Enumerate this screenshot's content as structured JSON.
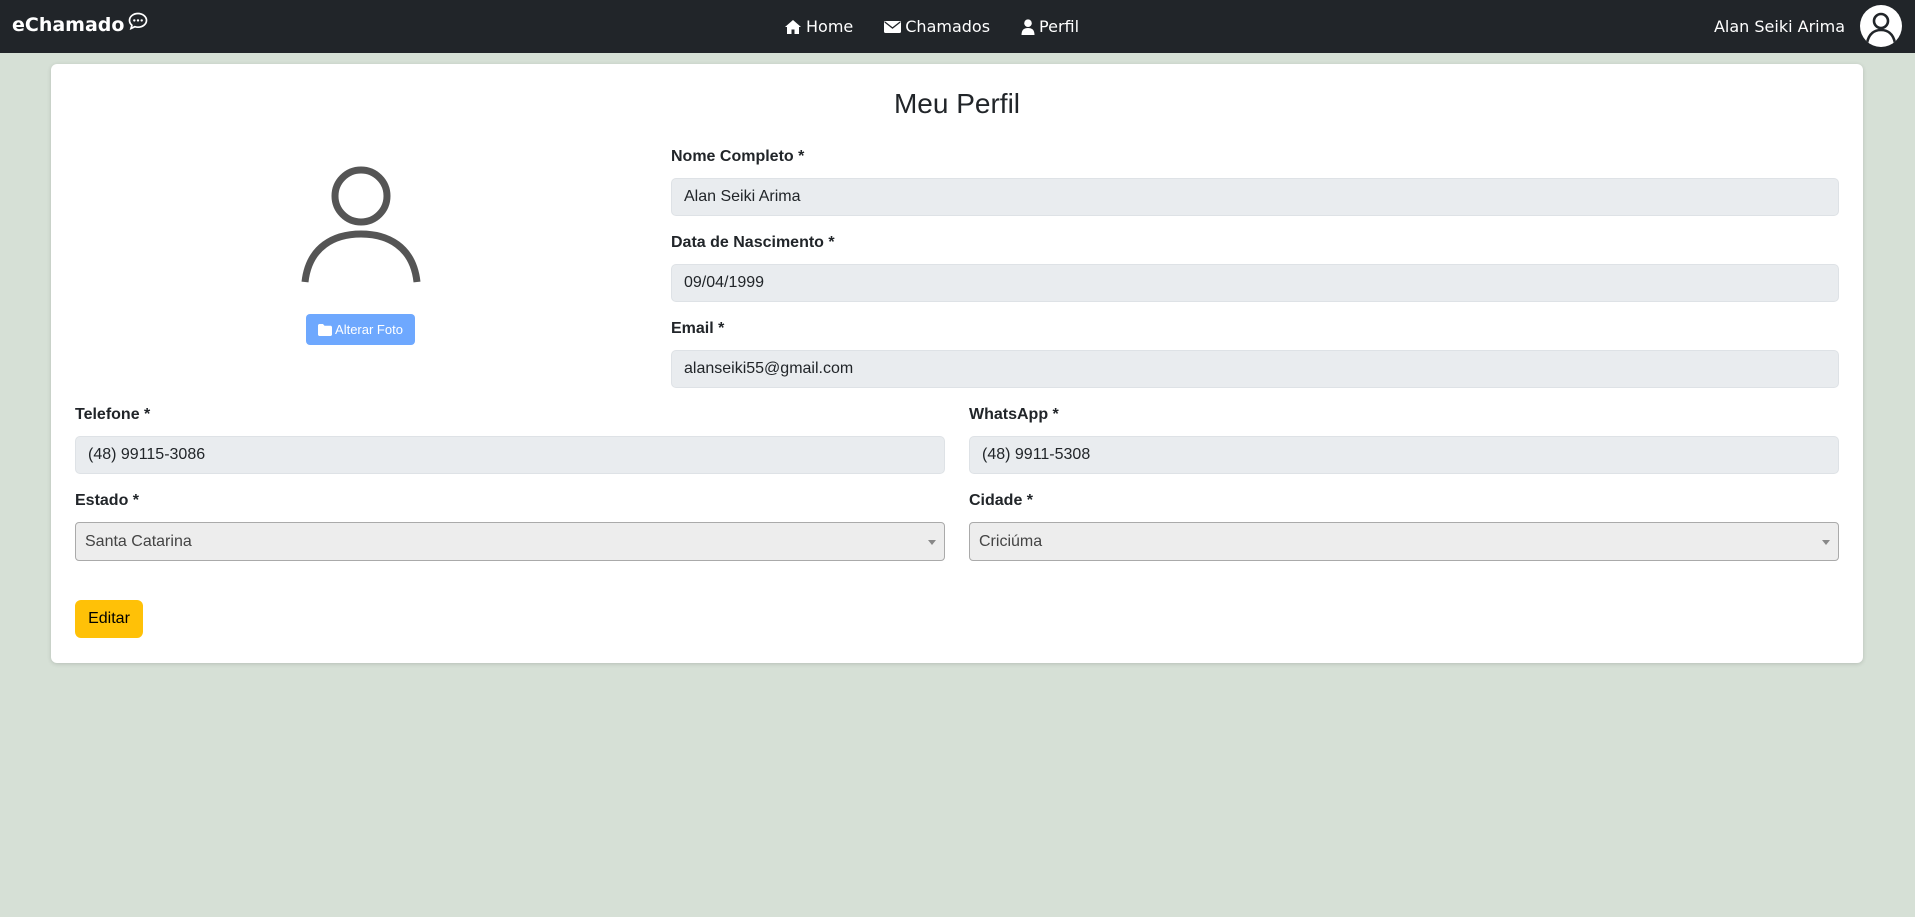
{
  "navbar": {
    "brand": "eChamado",
    "links": [
      {
        "label": "Home",
        "icon": "home-icon"
      },
      {
        "label": "Chamados",
        "icon": "envelope-icon"
      },
      {
        "label": "Perfil",
        "icon": "user-icon"
      }
    ],
    "user_name": "Alan Seiki Arima"
  },
  "page": {
    "title": "Meu Perfil",
    "photo_button": "Alterar Foto",
    "edit_button": "Editar"
  },
  "fields": {
    "nome": {
      "label": "Nome Completo *",
      "value": "Alan Seiki Arima"
    },
    "nascimento": {
      "label": "Data de Nascimento *",
      "value": "09/04/1999"
    },
    "email": {
      "label": "Email *",
      "value": "alanseiki55@gmail.com"
    },
    "telefone": {
      "label": "Telefone *",
      "value": "(48) 99115-3086"
    },
    "whatsapp": {
      "label": "WhatsApp *",
      "value": "(48) 9911-5308"
    },
    "estado": {
      "label": "Estado *",
      "value": "Santa Catarina"
    },
    "cidade": {
      "label": "Cidade *",
      "value": "Criciúma"
    }
  },
  "colors": {
    "navbar_bg": "#212529",
    "page_bg": "#d6e0d6",
    "photo_button_bg": "#6ea8fe",
    "edit_button_bg": "#ffc107",
    "input_bg": "#e9ecef"
  }
}
